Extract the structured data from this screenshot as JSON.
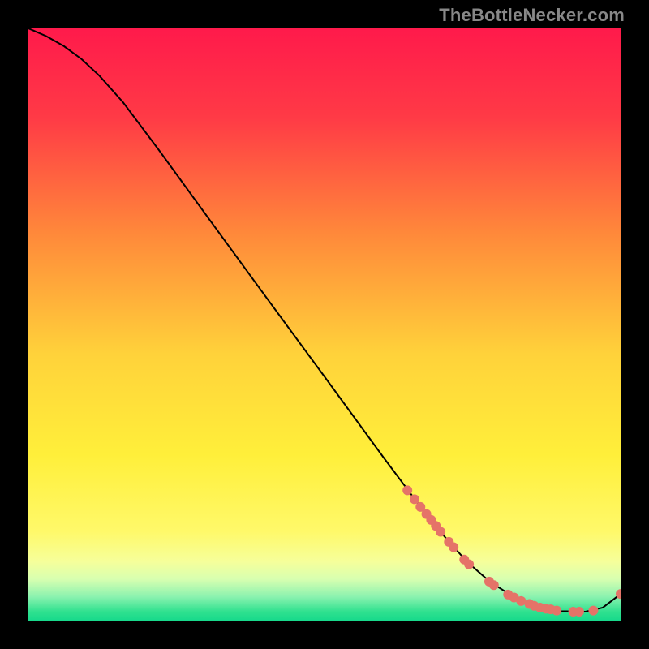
{
  "watermark": "TheBottleNecker.com",
  "chart_data": {
    "type": "line",
    "title": "",
    "xlabel": "",
    "ylabel": "",
    "xlim": [
      0,
      100
    ],
    "ylim": [
      0,
      100
    ],
    "grid": "off",
    "legend": "none",
    "background": {
      "type": "vertical-gradient",
      "stops": [
        {
          "pos": 0.0,
          "color": "#ff1a4b"
        },
        {
          "pos": 0.15,
          "color": "#ff3a46"
        },
        {
          "pos": 0.35,
          "color": "#ff8a3a"
        },
        {
          "pos": 0.55,
          "color": "#ffd23a"
        },
        {
          "pos": 0.72,
          "color": "#ffef3a"
        },
        {
          "pos": 0.85,
          "color": "#fff96a"
        },
        {
          "pos": 0.9,
          "color": "#f6ff9a"
        },
        {
          "pos": 0.93,
          "color": "#d8ffb0"
        },
        {
          "pos": 0.96,
          "color": "#8af2af"
        },
        {
          "pos": 0.985,
          "color": "#2fe18f"
        },
        {
          "pos": 1.0,
          "color": "#17d98b"
        }
      ]
    },
    "series": [
      {
        "name": "bottleneck-curve",
        "color": "#000000",
        "x": [
          0,
          3,
          6,
          9,
          12,
          16,
          22,
          30,
          40,
          50,
          60,
          66,
          70,
          74,
          78,
          82,
          86,
          90,
          94,
          97,
          100
        ],
        "y": [
          100,
          98.7,
          97.0,
          94.8,
          92.0,
          87.5,
          79.5,
          68.5,
          54.8,
          41.2,
          27.5,
          19.5,
          14.5,
          10.0,
          6.5,
          4.0,
          2.4,
          1.6,
          1.5,
          2.2,
          4.5
        ]
      }
    ],
    "scatter_points": {
      "name": "marked-points",
      "color": "#e57368",
      "radius": 6,
      "points": [
        {
          "x": 64.0,
          "y": 22.0
        },
        {
          "x": 65.2,
          "y": 20.5
        },
        {
          "x": 66.2,
          "y": 19.2
        },
        {
          "x": 67.2,
          "y": 18.0
        },
        {
          "x": 68.0,
          "y": 17.0
        },
        {
          "x": 68.8,
          "y": 16.0
        },
        {
          "x": 69.6,
          "y": 15.0
        },
        {
          "x": 71.0,
          "y": 13.3
        },
        {
          "x": 71.8,
          "y": 12.4
        },
        {
          "x": 73.6,
          "y": 10.3
        },
        {
          "x": 74.4,
          "y": 9.5
        },
        {
          "x": 77.8,
          "y": 6.6
        },
        {
          "x": 78.6,
          "y": 6.0
        },
        {
          "x": 81.0,
          "y": 4.4
        },
        {
          "x": 82.0,
          "y": 3.9
        },
        {
          "x": 83.2,
          "y": 3.3
        },
        {
          "x": 84.6,
          "y": 2.8
        },
        {
          "x": 85.4,
          "y": 2.5
        },
        {
          "x": 86.4,
          "y": 2.2
        },
        {
          "x": 87.4,
          "y": 2.0
        },
        {
          "x": 88.2,
          "y": 1.9
        },
        {
          "x": 89.2,
          "y": 1.7
        },
        {
          "x": 92.0,
          "y": 1.5
        },
        {
          "x": 93.0,
          "y": 1.5
        },
        {
          "x": 95.4,
          "y": 1.7
        },
        {
          "x": 100.0,
          "y": 4.5
        }
      ]
    }
  }
}
